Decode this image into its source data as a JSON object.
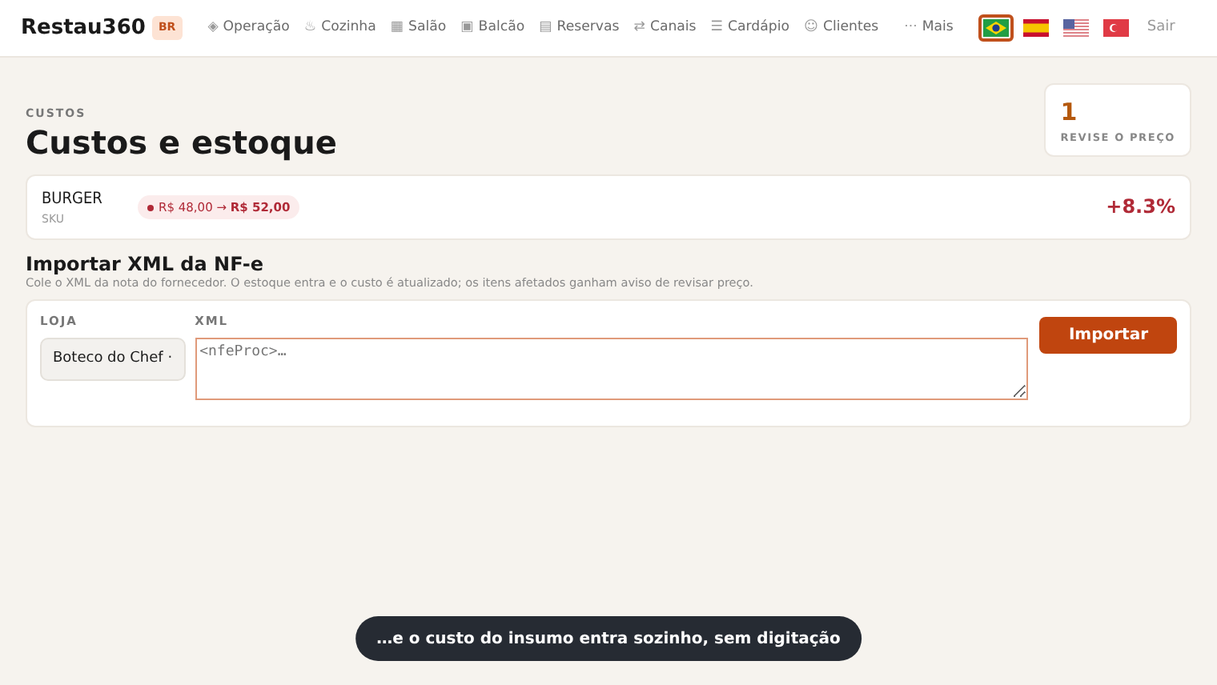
{
  "brand": {
    "name": "Restau360",
    "badge": "BR"
  },
  "nav": [
    {
      "icon": "◈",
      "label": "Operação"
    },
    {
      "icon": "♨",
      "label": "Cozinha"
    },
    {
      "icon": "▦",
      "label": "Salão"
    },
    {
      "icon": "▣",
      "label": "Balcão"
    },
    {
      "icon": "▤",
      "label": "Reservas"
    },
    {
      "icon": "⇄",
      "label": "Canais"
    },
    {
      "icon": "☰",
      "label": "Cardápio"
    },
    {
      "icon": "☺",
      "label": "Clientes"
    }
  ],
  "more": {
    "icon": "···",
    "label": "Mais"
  },
  "languages": [
    {
      "kind": "br",
      "selected": true
    },
    {
      "kind": "es",
      "selected": false
    },
    {
      "kind": "us",
      "selected": false
    },
    {
      "kind": "tr",
      "selected": false
    }
  ],
  "logout": "Sair",
  "page": {
    "eyebrow": "CUSTOS",
    "title": "Custos e estoque"
  },
  "stat": {
    "value": "1",
    "label": "REVISE O PREÇO"
  },
  "items": [
    {
      "name": "BURGER",
      "sku": "SKU",
      "change": "R$ 48,00 → **R$ 52,00**",
      "percent": "+8.3%"
    }
  ],
  "import": {
    "title": "Importar XML da NF-e",
    "description": "Cole o XML da nota do fornecedor. O estoque entra e o custo é atualizado; os itens afetados ganham aviso de revisar preço.",
    "store_label": "LOJA",
    "store_value": "Boteco do Chef ·",
    "xml_label": "XML",
    "xml_placeholder": "<nfeProc>…",
    "button": "Importar"
  },
  "toast": "…e o custo do insumo entra sozinho, sem digitação"
}
